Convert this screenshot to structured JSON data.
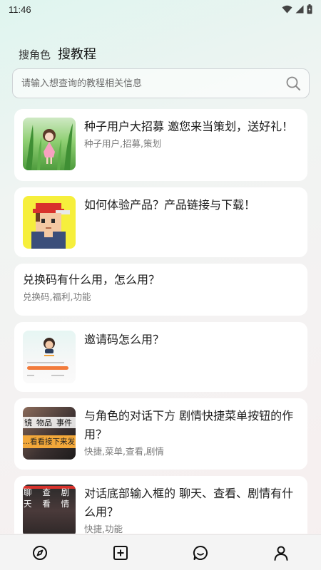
{
  "status_bar": {
    "time": "11:46",
    "icons": [
      "wifi-icon",
      "signal-icon",
      "battery-icon"
    ]
  },
  "tabs": [
    {
      "label": "搜角色",
      "active": false
    },
    {
      "label": "搜教程",
      "active": true
    }
  ],
  "search": {
    "placeholder": "请输入想查询的教程相关信息",
    "value": "",
    "icon": "search-icon"
  },
  "tutorials": [
    {
      "title": "种子用户大招募 邀您来当策划，送好礼！",
      "tags": "种子用户,招募,策划",
      "thumbnail": "girl-in-grass-thumbnail"
    },
    {
      "title": "如何体验产品？产品链接与下载！",
      "tags": "",
      "thumbnail": "pixel-boy-cap-thumbnail"
    },
    {
      "title": "兑换码有什么用，怎么用？",
      "tags": "兑换码,福利,功能",
      "thumbnail": ""
    },
    {
      "title": "邀请码怎么用？",
      "tags": "",
      "thumbnail": "invite-code-screen-thumbnail"
    },
    {
      "title": "与角色的对话下方 剧情快捷菜单按钮的作用？",
      "tags": "快捷,菜单,查看,剧情",
      "thumbnail": "chat-menu-screenshot-thumbnail",
      "thumb_text": [
        "镜",
        "物品",
        "事件",
        "...看看接下来发"
      ]
    },
    {
      "title": "对话底部输入框的 聊天、查看、剧情有什么用？",
      "tags": "快捷,功能",
      "thumbnail": "input-bar-screenshot-thumbnail",
      "thumb_text": [
        "聊天",
        "查看",
        "剧情"
      ]
    }
  ],
  "bottom_nav": [
    {
      "name": "discover",
      "icon": "compass-icon"
    },
    {
      "name": "create",
      "icon": "plus-square-icon"
    },
    {
      "name": "messages",
      "icon": "chat-bubble-icon"
    },
    {
      "name": "profile",
      "icon": "user-icon"
    }
  ]
}
